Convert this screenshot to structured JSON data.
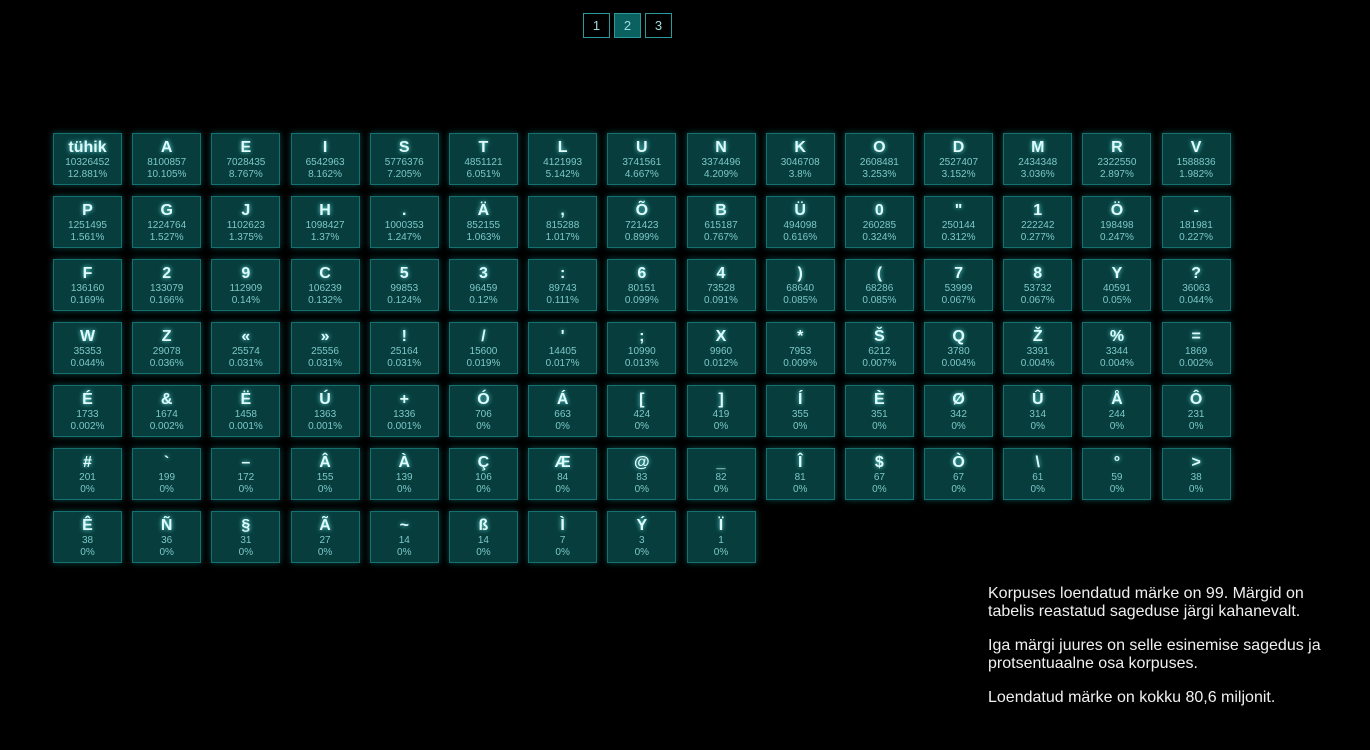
{
  "pagination": {
    "pages": [
      "1",
      "2",
      "3"
    ],
    "active": "2"
  },
  "chars": [
    {
      "ch": "tühik",
      "count": "10326452",
      "pct": "12.881%"
    },
    {
      "ch": "A",
      "count": "8100857",
      "pct": "10.105%"
    },
    {
      "ch": "E",
      "count": "7028435",
      "pct": "8.767%"
    },
    {
      "ch": "I",
      "count": "6542963",
      "pct": "8.162%"
    },
    {
      "ch": "S",
      "count": "5776376",
      "pct": "7.205%"
    },
    {
      "ch": "T",
      "count": "4851121",
      "pct": "6.051%"
    },
    {
      "ch": "L",
      "count": "4121993",
      "pct": "5.142%"
    },
    {
      "ch": "U",
      "count": "3741561",
      "pct": "4.667%"
    },
    {
      "ch": "N",
      "count": "3374496",
      "pct": "4.209%"
    },
    {
      "ch": "K",
      "count": "3046708",
      "pct": "3.8%"
    },
    {
      "ch": "O",
      "count": "2608481",
      "pct": "3.253%"
    },
    {
      "ch": "D",
      "count": "2527407",
      "pct": "3.152%"
    },
    {
      "ch": "M",
      "count": "2434348",
      "pct": "3.036%"
    },
    {
      "ch": "R",
      "count": "2322550",
      "pct": "2.897%"
    },
    {
      "ch": "V",
      "count": "1588836",
      "pct": "1.982%"
    },
    {
      "ch": "P",
      "count": "1251495",
      "pct": "1.561%"
    },
    {
      "ch": "G",
      "count": "1224764",
      "pct": "1.527%"
    },
    {
      "ch": "J",
      "count": "1102623",
      "pct": "1.375%"
    },
    {
      "ch": "H",
      "count": "1098427",
      "pct": "1.37%"
    },
    {
      "ch": ".",
      "count": "1000353",
      "pct": "1.247%"
    },
    {
      "ch": "Ä",
      "count": "852155",
      "pct": "1.063%"
    },
    {
      "ch": ",",
      "count": "815288",
      "pct": "1.017%"
    },
    {
      "ch": "Õ",
      "count": "721423",
      "pct": "0.899%"
    },
    {
      "ch": "B",
      "count": "615187",
      "pct": "0.767%"
    },
    {
      "ch": "Ü",
      "count": "494098",
      "pct": "0.616%"
    },
    {
      "ch": "0",
      "count": "260285",
      "pct": "0.324%"
    },
    {
      "ch": "\"",
      "count": "250144",
      "pct": "0.312%"
    },
    {
      "ch": "1",
      "count": "222242",
      "pct": "0.277%"
    },
    {
      "ch": "Ö",
      "count": "198498",
      "pct": "0.247%"
    },
    {
      "ch": "-",
      "count": "181981",
      "pct": "0.227%"
    },
    {
      "ch": "F",
      "count": "136160",
      "pct": "0.169%"
    },
    {
      "ch": "2",
      "count": "133079",
      "pct": "0.166%"
    },
    {
      "ch": "9",
      "count": "112909",
      "pct": "0.14%"
    },
    {
      "ch": "C",
      "count": "106239",
      "pct": "0.132%"
    },
    {
      "ch": "5",
      "count": "99853",
      "pct": "0.124%"
    },
    {
      "ch": "3",
      "count": "96459",
      "pct": "0.12%"
    },
    {
      "ch": ":",
      "count": "89743",
      "pct": "0.111%"
    },
    {
      "ch": "6",
      "count": "80151",
      "pct": "0.099%"
    },
    {
      "ch": "4",
      "count": "73528",
      "pct": "0.091%"
    },
    {
      "ch": ")",
      "count": "68640",
      "pct": "0.085%"
    },
    {
      "ch": "(",
      "count": "68286",
      "pct": "0.085%"
    },
    {
      "ch": "7",
      "count": "53999",
      "pct": "0.067%"
    },
    {
      "ch": "8",
      "count": "53732",
      "pct": "0.067%"
    },
    {
      "ch": "Y",
      "count": "40591",
      "pct": "0.05%"
    },
    {
      "ch": "?",
      "count": "36063",
      "pct": "0.044%"
    },
    {
      "ch": "W",
      "count": "35353",
      "pct": "0.044%"
    },
    {
      "ch": "Z",
      "count": "29078",
      "pct": "0.036%"
    },
    {
      "ch": "«",
      "count": "25574",
      "pct": "0.031%"
    },
    {
      "ch": "»",
      "count": "25556",
      "pct": "0.031%"
    },
    {
      "ch": "!",
      "count": "25164",
      "pct": "0.031%"
    },
    {
      "ch": "/",
      "count": "15600",
      "pct": "0.019%"
    },
    {
      "ch": "'",
      "count": "14405",
      "pct": "0.017%"
    },
    {
      "ch": ";",
      "count": "10990",
      "pct": "0.013%"
    },
    {
      "ch": "X",
      "count": "9960",
      "pct": "0.012%"
    },
    {
      "ch": "*",
      "count": "7953",
      "pct": "0.009%"
    },
    {
      "ch": "Š",
      "count": "6212",
      "pct": "0.007%"
    },
    {
      "ch": "Q",
      "count": "3780",
      "pct": "0.004%"
    },
    {
      "ch": "Ž",
      "count": "3391",
      "pct": "0.004%"
    },
    {
      "ch": "%",
      "count": "3344",
      "pct": "0.004%"
    },
    {
      "ch": "=",
      "count": "1869",
      "pct": "0.002%"
    },
    {
      "ch": "É",
      "count": "1733",
      "pct": "0.002%"
    },
    {
      "ch": "&",
      "count": "1674",
      "pct": "0.002%"
    },
    {
      "ch": "Ë",
      "count": "1458",
      "pct": "0.001%"
    },
    {
      "ch": "Ú",
      "count": "1363",
      "pct": "0.001%"
    },
    {
      "ch": "+",
      "count": "1336",
      "pct": "0.001%"
    },
    {
      "ch": "Ó",
      "count": "706",
      "pct": "0%"
    },
    {
      "ch": "Á",
      "count": "663",
      "pct": "0%"
    },
    {
      "ch": "[",
      "count": "424",
      "pct": "0%"
    },
    {
      "ch": "]",
      "count": "419",
      "pct": "0%"
    },
    {
      "ch": "Í",
      "count": "355",
      "pct": "0%"
    },
    {
      "ch": "È",
      "count": "351",
      "pct": "0%"
    },
    {
      "ch": "Ø",
      "count": "342",
      "pct": "0%"
    },
    {
      "ch": "Û",
      "count": "314",
      "pct": "0%"
    },
    {
      "ch": "Å",
      "count": "244",
      "pct": "0%"
    },
    {
      "ch": "Ô",
      "count": "231",
      "pct": "0%"
    },
    {
      "ch": "#",
      "count": "201",
      "pct": "0%"
    },
    {
      "ch": "`",
      "count": "199",
      "pct": "0%"
    },
    {
      "ch": "–",
      "count": "172",
      "pct": "0%"
    },
    {
      "ch": "Â",
      "count": "155",
      "pct": "0%"
    },
    {
      "ch": "À",
      "count": "139",
      "pct": "0%"
    },
    {
      "ch": "Ç",
      "count": "106",
      "pct": "0%"
    },
    {
      "ch": "Æ",
      "count": "84",
      "pct": "0%"
    },
    {
      "ch": "@",
      "count": "83",
      "pct": "0%"
    },
    {
      "ch": "_",
      "count": "82",
      "pct": "0%"
    },
    {
      "ch": "Î",
      "count": "81",
      "pct": "0%"
    },
    {
      "ch": "$",
      "count": "67",
      "pct": "0%"
    },
    {
      "ch": "Ò",
      "count": "67",
      "pct": "0%"
    },
    {
      "ch": "\\",
      "count": "61",
      "pct": "0%"
    },
    {
      "ch": "°",
      "count": "59",
      "pct": "0%"
    },
    {
      "ch": ">",
      "count": "38",
      "pct": "0%"
    },
    {
      "ch": "Ê",
      "count": "38",
      "pct": "0%"
    },
    {
      "ch": "Ñ",
      "count": "36",
      "pct": "0%"
    },
    {
      "ch": "§",
      "count": "31",
      "pct": "0%"
    },
    {
      "ch": "Ã",
      "count": "27",
      "pct": "0%"
    },
    {
      "ch": "~",
      "count": "14",
      "pct": "0%"
    },
    {
      "ch": "ß",
      "count": "14",
      "pct": "0%"
    },
    {
      "ch": "Ì",
      "count": "7",
      "pct": "0%"
    },
    {
      "ch": "Ý",
      "count": "3",
      "pct": "0%"
    },
    {
      "ch": "Ï",
      "count": "1",
      "pct": "0%"
    }
  ],
  "info": {
    "p1": "Korpuses loendatud märke on 99. Märgid on tabelis reastatud sageduse järgi kahanevalt.",
    "p2": "Iga märgi juures on selle esinemise sagedus ja protsentuaalne osa korpuses.",
    "p3": "Loendatud märke on kokku 80,6 miljonit."
  }
}
